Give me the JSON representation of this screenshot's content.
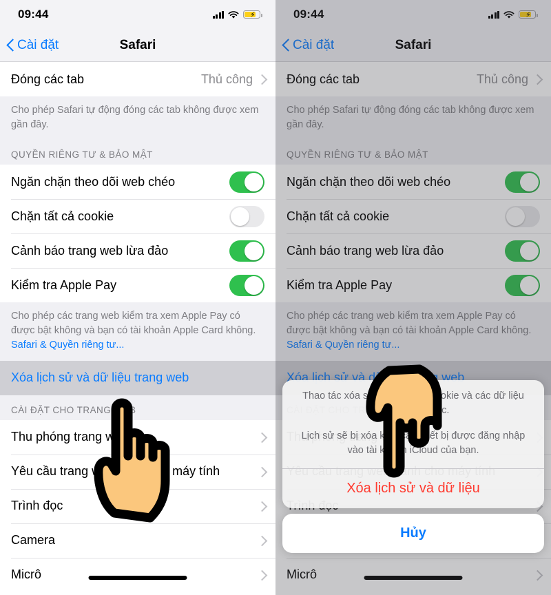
{
  "status_bar": {
    "time": "09:44",
    "signal_icon": "cellular-bars-icon",
    "wifi_icon": "wifi-icon",
    "battery_icon": "battery-charging-icon"
  },
  "nav": {
    "back_label": "Cài đặt",
    "title": "Safari"
  },
  "settings": {
    "close_tabs": {
      "label": "Đóng các tab",
      "value": "Thủ công"
    },
    "close_tabs_footer": "Cho phép Safari tự động đóng các tab không được xem gần đây.",
    "privacy_header": "QUYỀN RIÊNG TƯ & BẢO MẬT",
    "toggles": [
      {
        "label": "Ngăn chặn theo dõi web chéo",
        "on": true
      },
      {
        "label": "Chặn tất cả cookie",
        "on": false
      },
      {
        "label": "Cảnh báo trang web lừa đảo",
        "on": true
      },
      {
        "label": "Kiểm tra Apple Pay",
        "on": true
      }
    ],
    "apple_pay_footer": "Cho phép các trang web kiểm tra xem Apple Pay có được bật không và bạn có tài khoản Apple Card không.",
    "apple_pay_link": "Safari & Quyền riêng tư...",
    "clear_history_label": "Xóa lịch sử và dữ liệu trang web",
    "site_settings_header": "CÀI ĐẶT CHO TRANG WEB",
    "site_rows": [
      {
        "label": "Thu phóng trang web"
      },
      {
        "label": "Yêu cầu trang web dành cho máy tính"
      },
      {
        "label": "Trình đọc"
      },
      {
        "label": "Camera"
      },
      {
        "label": "Micrô"
      }
    ]
  },
  "action_sheet": {
    "message_line1": "Thao tác xóa sẽ xóa lịch sử, cookie và các dữ liệu duyệt web khác.",
    "message_line2": "Lịch sử sẽ bị xóa khỏi các thiết bị được đăng nhập vào tài khoản iCloud của bạn.",
    "destructive_label": "Xóa lịch sử và dữ liệu",
    "cancel_label": "Hủy"
  },
  "colors": {
    "accent_blue": "#0a7cff",
    "toggle_green": "#2fc04e",
    "destructive_red": "#ff3b30",
    "battery_yellow": "#fdd017",
    "hand_skin": "#fbc77d"
  },
  "cursor": {
    "icon": "pointing-hand-cursor"
  }
}
